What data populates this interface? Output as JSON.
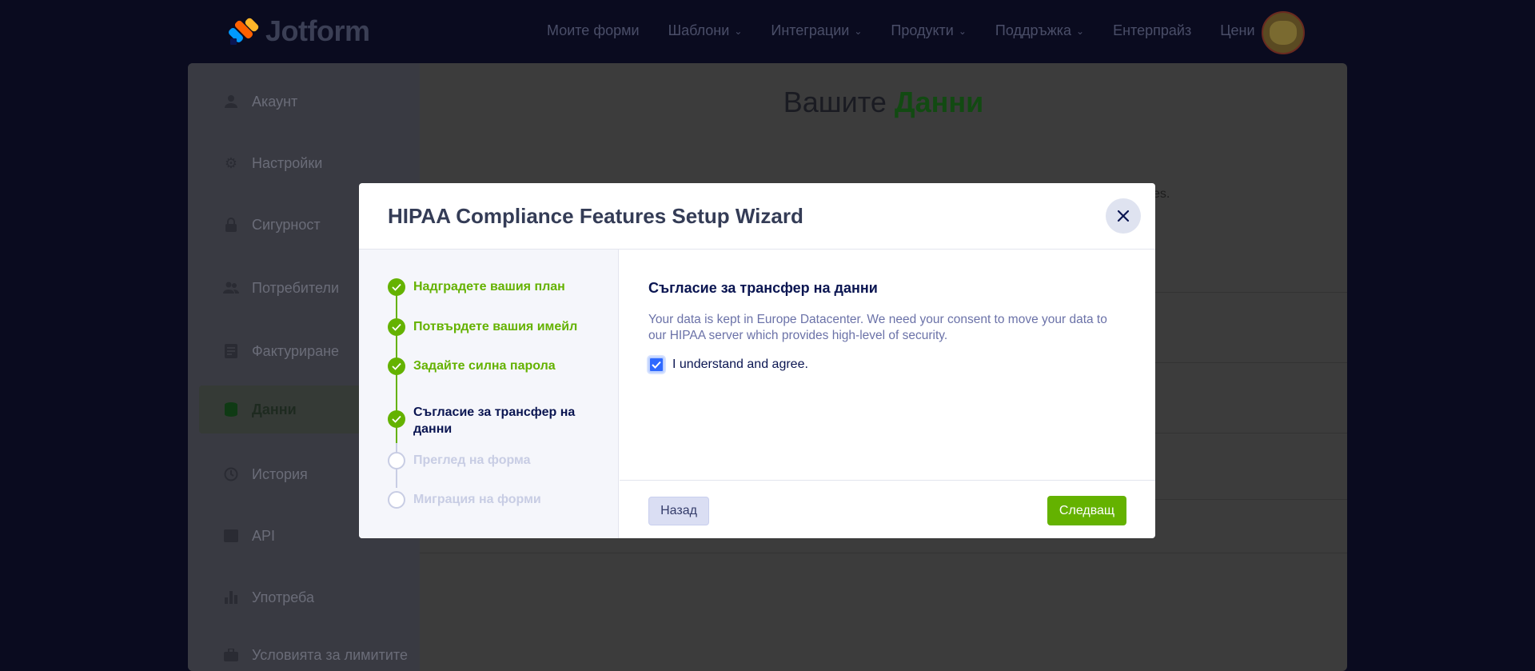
{
  "brand": {
    "name": "Jotform"
  },
  "nav": {
    "items": [
      {
        "label": "Моите форми",
        "has_menu": false
      },
      {
        "label": "Шаблони",
        "has_menu": true
      },
      {
        "label": "Интеграции",
        "has_menu": true
      },
      {
        "label": "Продукти",
        "has_menu": true
      },
      {
        "label": "Поддръжка",
        "has_menu": true
      },
      {
        "label": "Ентерпрайз",
        "has_menu": false
      },
      {
        "label": "Цени",
        "has_menu": false
      }
    ]
  },
  "sidebar": {
    "items": [
      {
        "label": "Акаунт",
        "icon": "user-icon"
      },
      {
        "label": "Настройки",
        "icon": "gear-icon"
      },
      {
        "label": "Сигурност",
        "icon": "lock-icon"
      },
      {
        "label": "Потребители",
        "icon": "users-icon"
      },
      {
        "label": "Фактуриране",
        "icon": "invoice-icon"
      },
      {
        "label": "Данни",
        "icon": "database-icon",
        "active": true
      },
      {
        "label": "История",
        "icon": "history-icon"
      },
      {
        "label": "API",
        "icon": "api-icon"
      },
      {
        "label": "Употреба",
        "icon": "bar-chart-icon"
      },
      {
        "label": "Условията за лимитите",
        "icon": "briefcase-icon"
      }
    ]
  },
  "main": {
    "title_plain": "Вашите",
    "title_accent": "Данни",
    "partial_text": "es."
  },
  "modal": {
    "title": "HIPAA Compliance Features Setup Wizard",
    "close_icon": "close-icon",
    "steps": [
      {
        "label": "Надградете вашия план",
        "state": "done"
      },
      {
        "label": "Потвърдете вашия имейл",
        "state": "done"
      },
      {
        "label": "Задайте силна парола",
        "state": "done"
      },
      {
        "label": "Съгласие за трансфер на данни",
        "state": "current"
      },
      {
        "label": "Преглед на форма",
        "state": "todo"
      },
      {
        "label": "Миграция на форми",
        "state": "todo"
      }
    ],
    "content": {
      "heading": "Съгласие за трансфер на данни",
      "description": "Your data is kept in Europe Datacenter. We need your consent to move your data to our HIPAA server which provides high-level of security.",
      "checkbox_label": "I understand and agree.",
      "checkbox_checked": true
    },
    "footer": {
      "back_label": "Назад",
      "next_label": "Следващ"
    }
  },
  "colors": {
    "accent_green": "#64b200",
    "navy": "#0a1551",
    "checkbox_blue": "#2e69ff"
  }
}
